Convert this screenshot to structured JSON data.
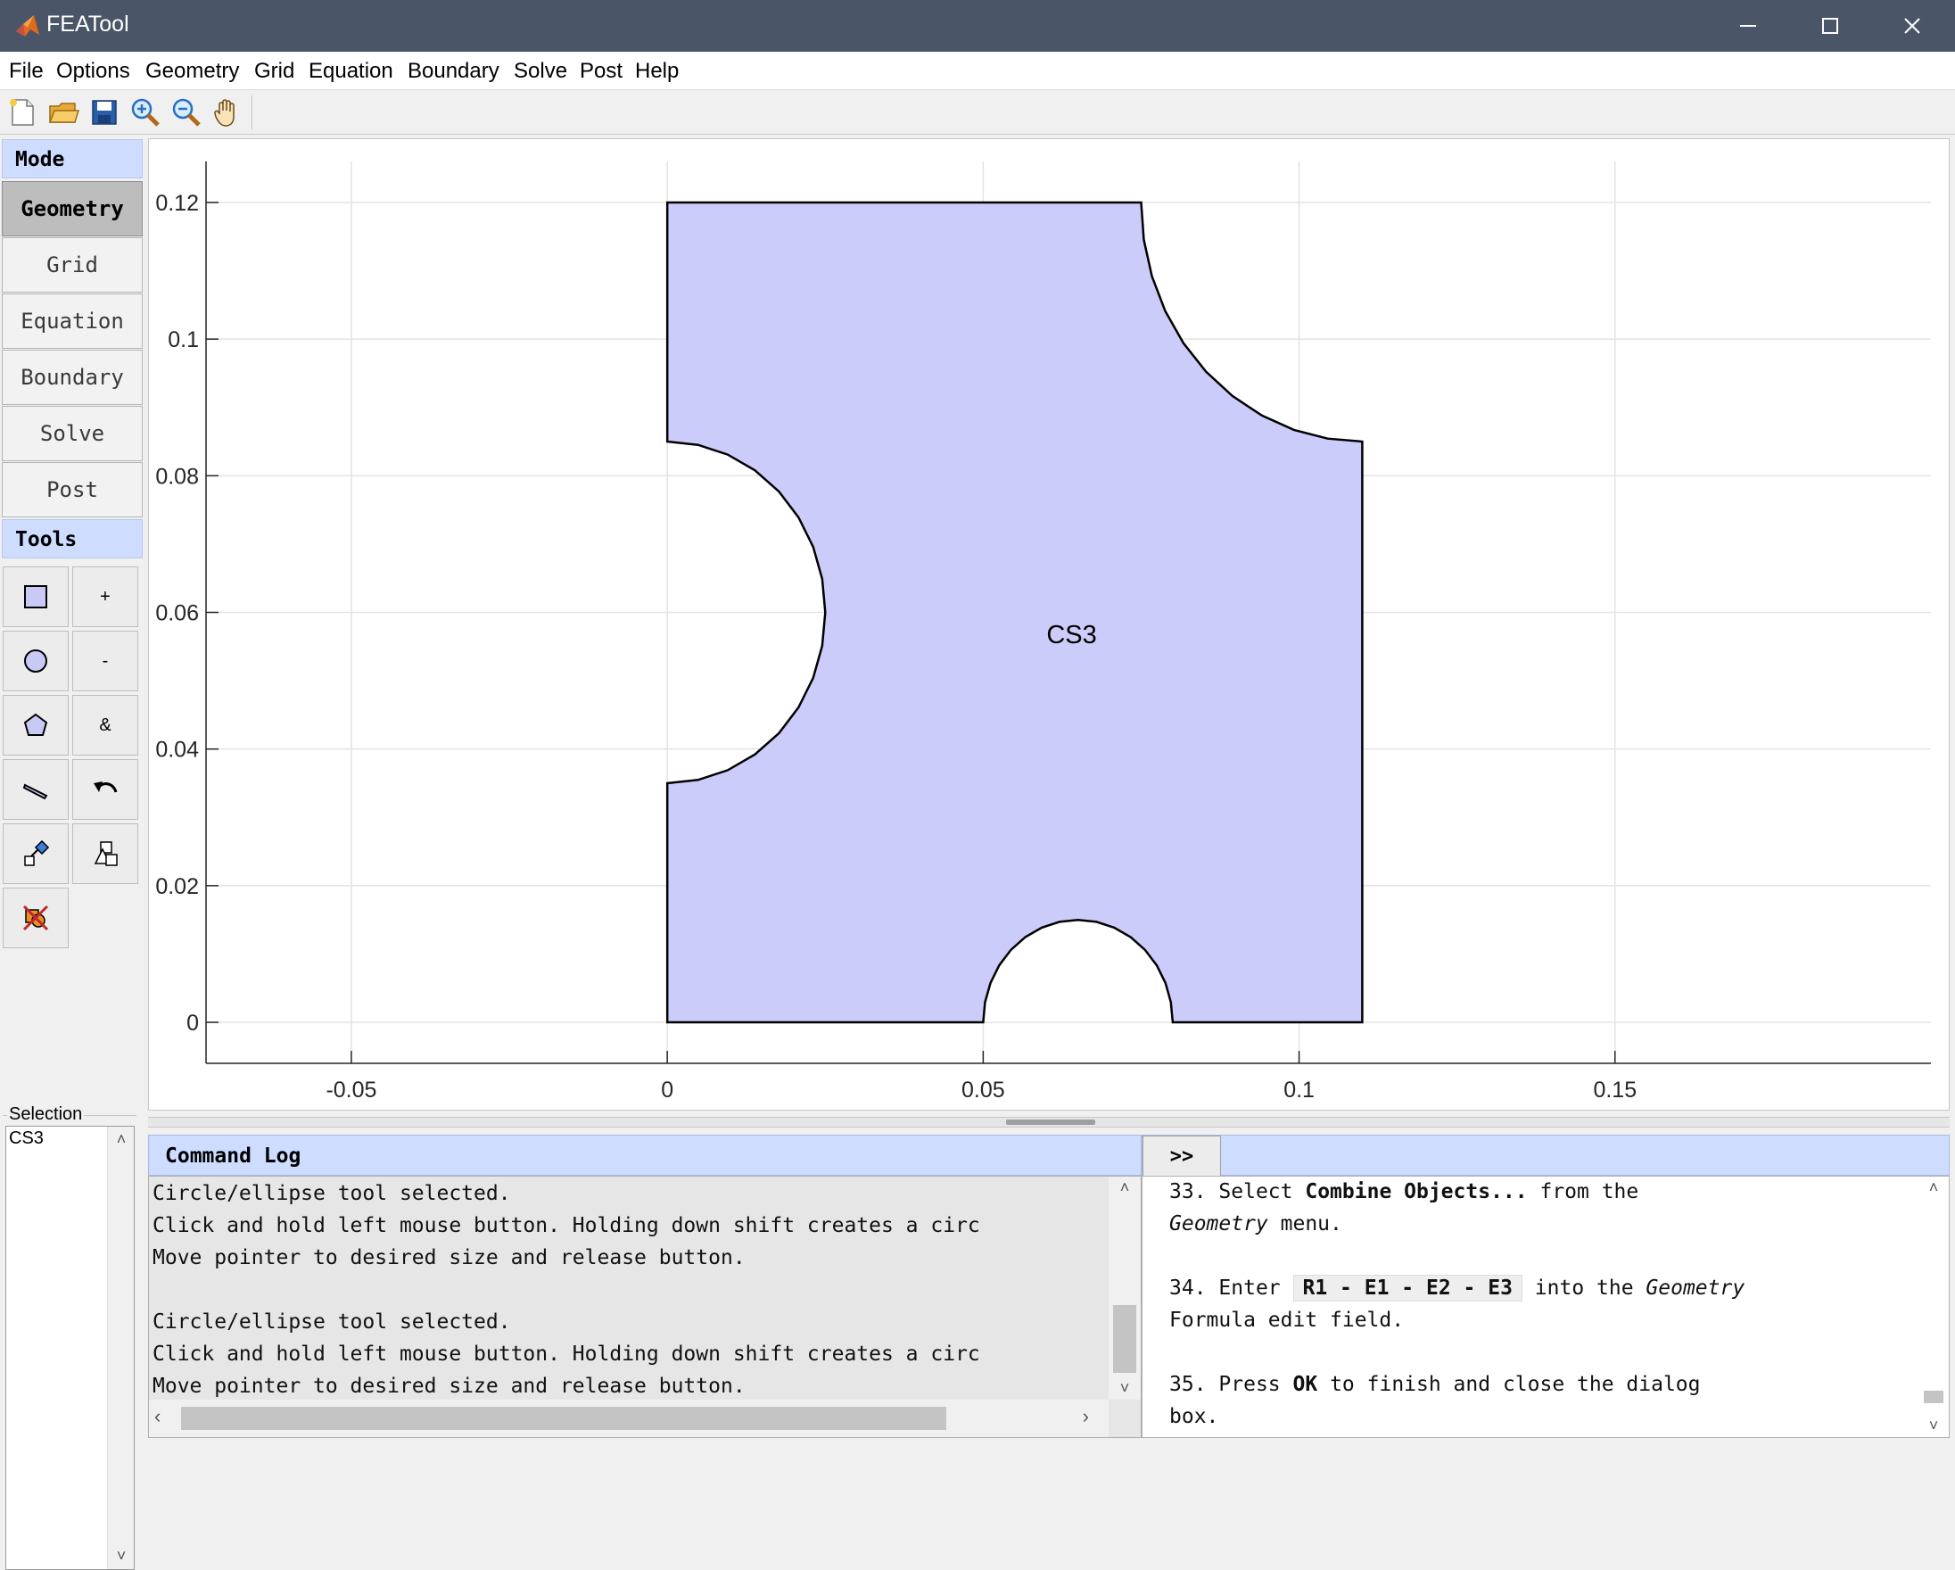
{
  "window": {
    "title": "FEATool",
    "minimize_glyph": "—",
    "maximize_glyph": "☐",
    "close_glyph": "✕"
  },
  "menu": {
    "items": [
      "File",
      "Options",
      "Geometry",
      "Grid",
      "Equation",
      "Boundary",
      "Solve",
      "Post",
      "Help"
    ]
  },
  "toolbar": {
    "icons": [
      "new-file-icon",
      "open-folder-icon",
      "save-icon",
      "zoom-in-icon",
      "zoom-out-icon",
      "pan-hand-icon"
    ]
  },
  "left_panel": {
    "mode_header": "Mode",
    "modes": [
      "Geometry",
      "Grid",
      "Equation",
      "Boundary",
      "Solve",
      "Post"
    ],
    "active_mode": "Geometry",
    "tools_header": "Tools",
    "tools": [
      {
        "icon": "rectangle-icon",
        "text": ""
      },
      {
        "icon": "join-icon",
        "text": "+"
      },
      {
        "icon": "circle-icon",
        "text": ""
      },
      {
        "icon": "subtract-icon",
        "text": "-"
      },
      {
        "icon": "polygon-icon",
        "text": ""
      },
      {
        "icon": "intersect-icon",
        "text": "&"
      },
      {
        "icon": "line-icon",
        "text": ""
      },
      {
        "icon": "undo-icon",
        "text": ""
      },
      {
        "icon": "transform-icon",
        "text": ""
      },
      {
        "icon": "scale-icon",
        "text": ""
      },
      {
        "icon": "delete-icon",
        "text": ""
      }
    ],
    "selection_label": "Selection",
    "selection_items": [
      "CS3"
    ]
  },
  "plot": {
    "object_label": "CS3",
    "x_ticks": [
      "-0.05",
      "0",
      "0.05",
      "0.1",
      "0.15"
    ],
    "y_ticks": [
      "0",
      "0.02",
      "0.04",
      "0.06",
      "0.08",
      "0.1",
      "0.12"
    ],
    "fill_color": "#ccccfa",
    "x_range": [
      -0.073,
      0.2
    ],
    "y_range": [
      -0.006,
      0.126
    ],
    "geometry": {
      "rectangle": {
        "x": [
          0,
          0.11
        ],
        "y": [
          0,
          0.12
        ]
      },
      "left_circle": {
        "center": [
          0,
          0.06
        ],
        "radius": 0.025
      },
      "bottom_circle": {
        "center": [
          0.065,
          0
        ],
        "radius": 0.015
      },
      "top_right_circle": {
        "center": [
          0.11,
          0.12
        ],
        "radius": 0.035
      }
    }
  },
  "command_log": {
    "title": "Command Log",
    "lines": [
      "Circle/ellipse tool selected.",
      "Click and hold left mouse button. Holding down shift creates a circ",
      "Move pointer to desired size and release button.",
      "",
      "Circle/ellipse tool selected.",
      "Click and hold left mouse button. Holding down shift creates a circ",
      "Move pointer to desired size and release button."
    ]
  },
  "help": {
    "toggle_label": ">>",
    "step33_num": "33.",
    "step33_pre": "Select",
    "step33_bold": "Combine Objects...",
    "step33_post": "from the",
    "step33_italic": "Geometry",
    "step33_end": "menu.",
    "step34_num": "34.",
    "step34_pre": "Enter",
    "step34_code": "R1 - E1 - E2 - E3",
    "step34_post": "into the",
    "step34_italic": "Geometry",
    "step34_end": "Formula edit field.",
    "step35_num": "35.",
    "step35_pre": "Press",
    "step35_bold": "OK",
    "step35_post": "to finish and close the dialog",
    "step35_end": "box."
  }
}
